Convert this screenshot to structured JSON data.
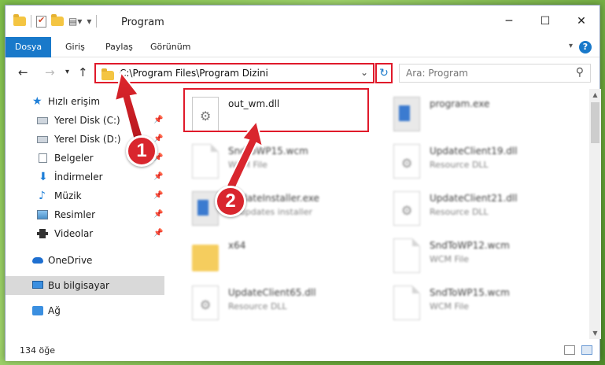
{
  "window": {
    "title": "Program",
    "controls": [
      "─",
      "☐",
      "✕"
    ]
  },
  "ribbon": {
    "tabs": [
      "Dosya",
      "Giriş",
      "Paylaş",
      "Görünüm"
    ],
    "help": "?"
  },
  "nav": {
    "address": "C:\\Program Files\\Program Dizini",
    "search_placeholder": "Ara: Program"
  },
  "sidebar": {
    "items": [
      {
        "label": "Hızlı erişim",
        "icon": "star-icon",
        "pinned": false
      },
      {
        "label": "Yerel Disk (C:)",
        "icon": "drive-icon",
        "pinned": true
      },
      {
        "label": "Yerel Disk (D:)",
        "icon": "drive-icon",
        "pinned": true
      },
      {
        "label": "Belgeler",
        "icon": "documents-icon",
        "pinned": true
      },
      {
        "label": "İndirmeler",
        "icon": "download-icon",
        "pinned": true
      },
      {
        "label": "Müzik",
        "icon": "music-icon",
        "pinned": true
      },
      {
        "label": "Resimler",
        "icon": "pictures-icon",
        "pinned": true
      },
      {
        "label": "Videolar",
        "icon": "videos-icon",
        "pinned": true
      },
      {
        "label": "OneDrive",
        "icon": "onedrive-icon",
        "pinned": false
      },
      {
        "label": "Bu bilgisayar",
        "icon": "this-pc-icon",
        "pinned": false
      },
      {
        "label": "Ağ",
        "icon": "network-icon",
        "pinned": false
      }
    ]
  },
  "files": [
    {
      "name": "out_wm.dll",
      "type": "",
      "icon": "dll-file-icon"
    },
    {
      "name": "program.exe",
      "type": "",
      "icon": "exe-file-icon"
    },
    {
      "name": "SndToWP15.wcm",
      "type": "WCM File",
      "icon": "document-icon"
    },
    {
      "name": "UpdateClient19.dll",
      "type": "Resource DLL",
      "icon": "dll-file-icon"
    },
    {
      "name": "UpdateInstaller.exe",
      "type": "UI updates installer",
      "icon": "installer-icon"
    },
    {
      "name": "UpdateClient21.dll",
      "type": "Resource DLL",
      "icon": "dll-file-icon"
    },
    {
      "name": "x64",
      "type": "",
      "icon": "folder-icon"
    },
    {
      "name": "SndToWP12.wcm",
      "type": "WCM File",
      "icon": "document-icon"
    },
    {
      "name": "UpdateClient65.dll",
      "type": "Resource DLL",
      "icon": "dll-file-icon"
    },
    {
      "name": "SndToWP15.wcm",
      "type": "WCM File",
      "icon": "document-icon"
    }
  ],
  "status": {
    "item_count": "134 öğe"
  },
  "annotations": {
    "step1": "1",
    "step2": "2"
  },
  "colors": {
    "accent": "#1979ca",
    "highlight": "#e0192a",
    "badge": "#d9262e"
  }
}
